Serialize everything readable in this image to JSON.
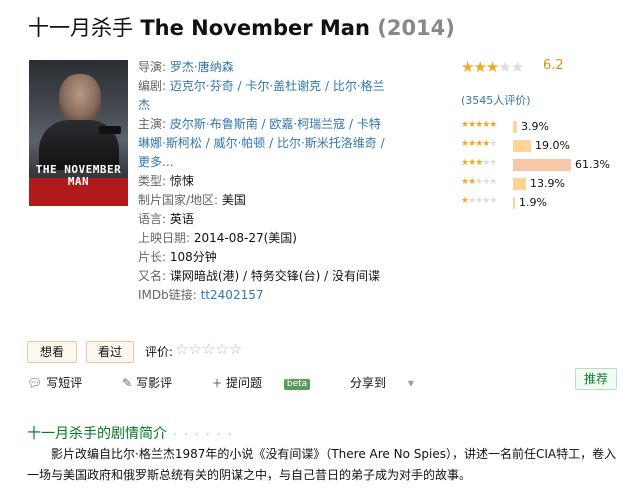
{
  "header": {
    "title_cn": "十一月杀手",
    "title_en": "The November Man",
    "year": "(2014)"
  },
  "poster": {
    "text_line1": "THE NOVEMBER",
    "text_line2": "MAN"
  },
  "info": {
    "director_label": "导演:",
    "director": "罗杰·唐纳森",
    "writer_label": "编剧:",
    "writers": "迈克尔·芬奇 / 卡尔·盖杜谢克 / 比尔·格兰杰",
    "cast_label": "主演:",
    "cast": "皮尔斯·布鲁斯南 / 欧嘉·柯瑞兰寇 / 卡特琳娜·斯柯松 / 威尔·帕顿 / 比尔·斯米托洛维奇 / 更多...",
    "genre_label": "类型:",
    "genre": "惊悚",
    "country_label": "制片国家/地区:",
    "country": "美国",
    "language_label": "语言:",
    "language": "英语",
    "release_label": "上映日期:",
    "release": "2014-08-27(美国)",
    "runtime_label": "片长:",
    "runtime": "108分钟",
    "aka_label": "又名:",
    "aka": "谍网暗战(港) / 特务交锋(台) / 没有间谍",
    "imdb_label": "IMDb链接:",
    "imdb": "tt2402157"
  },
  "rating": {
    "score": "6.2",
    "stars_filled": 3,
    "count_text": "(3545人评价)",
    "distribution": [
      {
        "stars": 5,
        "percent": 3.9,
        "label": "3.9%"
      },
      {
        "stars": 4,
        "percent": 19.0,
        "label": "19.0%"
      },
      {
        "stars": 3,
        "percent": 61.3,
        "label": "61.3%"
      },
      {
        "stars": 2,
        "percent": 13.9,
        "label": "13.9%"
      },
      {
        "stars": 1,
        "percent": 1.9,
        "label": "1.9%"
      }
    ],
    "colors": {
      "star_on": "#f5a623",
      "star_off": "#dddddd",
      "bar": "#ffd596"
    }
  },
  "actions": {
    "want_label": "想看",
    "seen_label": "看过",
    "rate_label": "评价:",
    "short_review": "写短评",
    "review": "写影评",
    "ask": "提问题",
    "beta": "beta",
    "share": "分享到",
    "recommend": "推荐"
  },
  "synopsis": {
    "heading": "十一月杀手的剧情简介",
    "dots": "· · · · · ·",
    "text": "影片改编自比尔·格兰杰1987年的小说《没有间谍》（There Are No Spies），讲述一名前任CIA特工，卷入一场与美国政府和俄罗斯总统有关的阴谋之中，与自己昔日的弟子成为对手的故事。"
  }
}
